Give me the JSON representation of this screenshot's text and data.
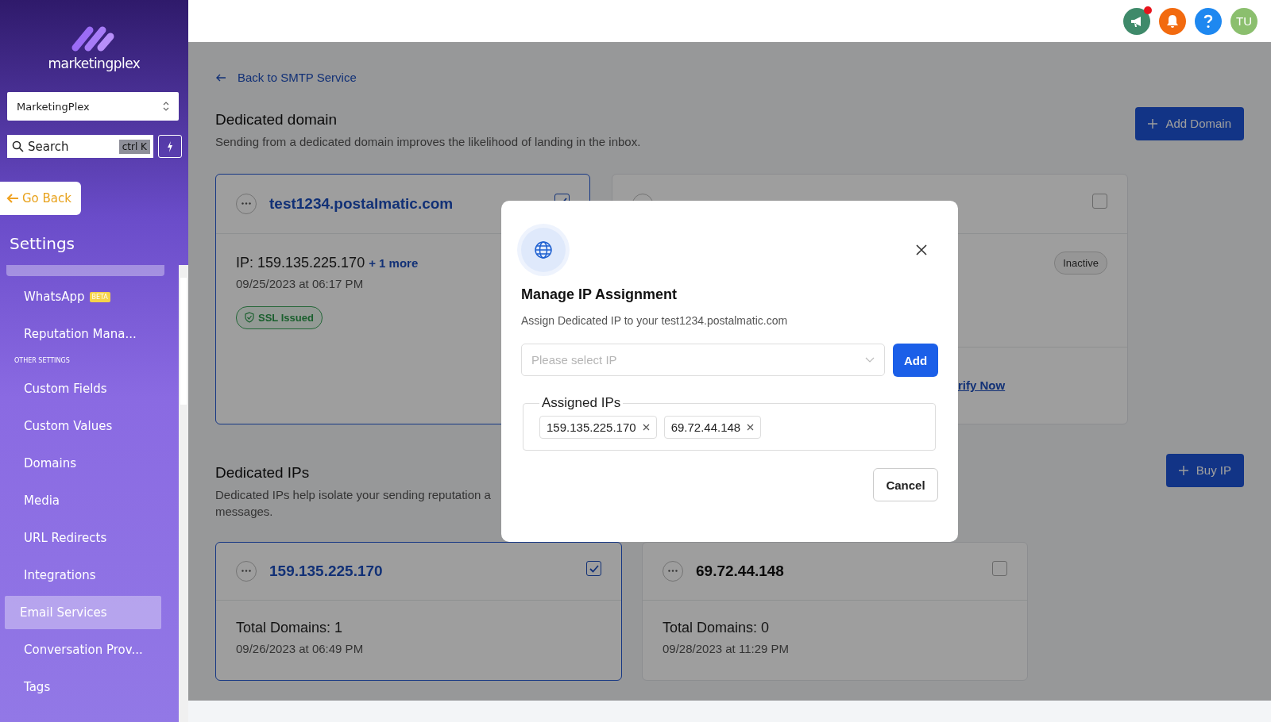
{
  "topbar": {
    "icons": [
      {
        "kind": "announce",
        "dot": true
      },
      {
        "kind": "bell",
        "dot": false
      },
      {
        "kind": "help",
        "dot": false
      }
    ],
    "avatar": "TU"
  },
  "sidebar": {
    "logo": "marketingplex",
    "account": "MarketingPlex",
    "search": {
      "placeholder": "Search",
      "shortcut": "ctrl K"
    },
    "go_back": "Go Back",
    "section_title": "Settings",
    "items": [
      {
        "kind": "item",
        "label": "WhatsApp",
        "badge": "BETA",
        "selected": false
      },
      {
        "kind": "item",
        "label": "Reputation Mana...",
        "selected": false
      },
      {
        "kind": "header",
        "label": "OTHER SETTINGS"
      },
      {
        "kind": "item",
        "label": "Custom Fields",
        "selected": false
      },
      {
        "kind": "item",
        "label": "Custom Values",
        "selected": false
      },
      {
        "kind": "item",
        "label": "Domains",
        "selected": false
      },
      {
        "kind": "item",
        "label": "Media",
        "selected": false
      },
      {
        "kind": "item",
        "label": "URL Redirects",
        "selected": false
      },
      {
        "kind": "item",
        "label": "Integrations",
        "selected": false
      },
      {
        "kind": "item",
        "label": "Email Services",
        "selected": true
      },
      {
        "kind": "item",
        "label": "Conversation Prov...",
        "selected": false
      },
      {
        "kind": "item",
        "label": "Tags",
        "selected": false
      }
    ]
  },
  "back_link": "Back to SMTP Service",
  "domains": {
    "title": "Dedicated domain",
    "description": "Sending from a dedicated domain improves the likelihood of landing in the inbox.",
    "add_button": "Add Domain",
    "cards": [
      {
        "title": "test1234.postalmatic.com",
        "ip": "IP: 159.135.225.170",
        "more": "+ 1 more",
        "date": "09/25/2023 at 06:17 PM",
        "badge": "SSL Issued",
        "checked": true,
        "selected": true
      },
      {
        "status": "Inactive",
        "link": "rify Now",
        "checked": false,
        "selected": false
      }
    ]
  },
  "ips": {
    "title": "Dedicated IPs",
    "description": [
      "Dedicated IPs help isolate your sending reputation a",
      "messages."
    ],
    "buy_button": "Buy IP",
    "cards": [
      {
        "ip": "159.135.225.170",
        "total": "Total Domains: 1",
        "date": "09/26/2023 at 06:49 PM",
        "checked": true,
        "selected": true
      },
      {
        "ip": "69.72.44.148",
        "total": "Total Domains: 0",
        "date": "09/28/2023 at 11:29 PM",
        "checked": false,
        "selected": false
      }
    ]
  },
  "modal": {
    "title": "Manage IP Assignment",
    "subtitle": "Assign Dedicated IP to your test1234.postalmatic.com",
    "select_placeholder": "Please select IP",
    "add_button": "Add",
    "assigned_title": "Assigned IPs",
    "assigned": [
      "159.135.225.170",
      "69.72.44.148"
    ],
    "cancel_button": "Cancel"
  }
}
